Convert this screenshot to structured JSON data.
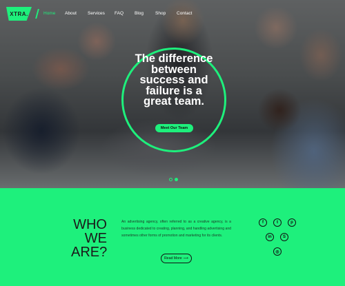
{
  "brand": {
    "logo_text": "XTRA."
  },
  "nav": {
    "items": [
      {
        "label": "Home",
        "active": true
      },
      {
        "label": "About"
      },
      {
        "label": "Services"
      },
      {
        "label": "FAQ"
      },
      {
        "label": "Blog"
      },
      {
        "label": "Shop"
      },
      {
        "label": "Contact"
      }
    ]
  },
  "hero": {
    "headline": "The difference between success and failure is a great team.",
    "cta_label": "Meet Our Team",
    "slides": {
      "count": 2,
      "active": 2
    }
  },
  "about": {
    "heading_lines": [
      "WHO",
      "WE",
      "ARE?"
    ],
    "body": "An advertising agency, often referred to as a creative agency, is a business dedicated to creating, planning, and handling advertising and sometimes other forms of promotion and marketing for its clients.",
    "read_more_label": "Read More",
    "read_more_arrow": "⟶"
  },
  "social": [
    {
      "icon": "facebook-icon",
      "glyph": "f"
    },
    {
      "icon": "twitter-icon",
      "glyph": "t"
    },
    {
      "icon": "pinterest-icon",
      "glyph": "p"
    },
    {
      "icon": "linkedin-icon",
      "glyph": "in"
    },
    {
      "icon": "skype-icon",
      "glyph": "S"
    },
    {
      "icon": "instagram-icon",
      "glyph": "◎"
    }
  ],
  "colors": {
    "accent": "#1ef07c",
    "text_dark": "#1a1a1a"
  }
}
